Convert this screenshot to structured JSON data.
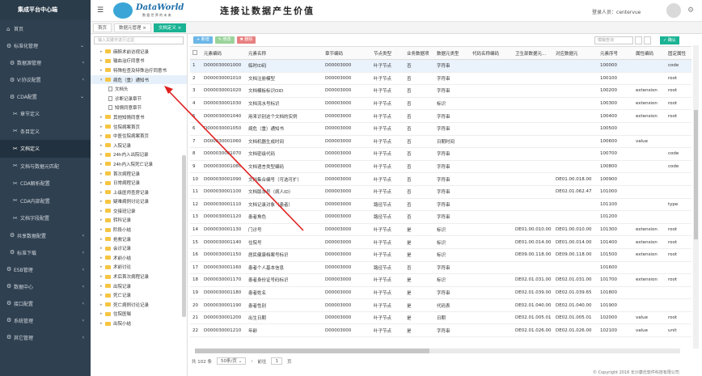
{
  "app": {
    "sidebar_title": "集成平台中心端"
  },
  "sidebar": {
    "items": [
      {
        "label": "首页",
        "icon": "home-icon",
        "level": 0
      },
      {
        "label": "标准化管理",
        "icon": "gear-icon",
        "level": 0,
        "arrow": "⌄"
      },
      {
        "label": "数据源管理",
        "icon": "cog-icon",
        "level": 1,
        "arrow": "‹"
      },
      {
        "label": "V:协议配置",
        "icon": "cog-icon",
        "level": 1,
        "arrow": "‹"
      },
      {
        "label": "CDA配置",
        "icon": "cog-icon",
        "level": 1,
        "arrow": "⌄"
      },
      {
        "label": "章节定义",
        "icon": "tool-icon",
        "level": 2
      },
      {
        "label": "条目定义",
        "icon": "tool-icon",
        "level": 2
      },
      {
        "label": "文档定义",
        "icon": "tool-icon",
        "level": 2,
        "active": true
      },
      {
        "label": "文档与数据元匹配",
        "icon": "tool-icon",
        "level": 2
      },
      {
        "label": "CDA解析配置",
        "icon": "tool-icon",
        "level": 2
      },
      {
        "label": "CDA内部配置",
        "icon": "tool-icon",
        "level": 2
      },
      {
        "label": "文档字段配置",
        "icon": "tool-icon",
        "level": 2
      },
      {
        "label": "共享数据配置",
        "icon": "cog-icon",
        "level": 1,
        "arrow": "‹"
      },
      {
        "label": "标准下载",
        "icon": "cog-icon",
        "level": 1,
        "arrow": "‹"
      },
      {
        "label": "ESB管理",
        "icon": "gear-icon",
        "level": 0,
        "arrow": "‹"
      },
      {
        "label": "数据中心",
        "icon": "gear-icon",
        "level": 0,
        "arrow": "‹"
      },
      {
        "label": "接口配置",
        "icon": "gear-icon",
        "level": 0,
        "arrow": "‹"
      },
      {
        "label": "系统管理",
        "icon": "gear-icon",
        "level": 0,
        "arrow": "‹"
      },
      {
        "label": "其它管理",
        "icon": "gear-icon",
        "level": 0,
        "arrow": "‹"
      }
    ]
  },
  "header": {
    "brand": "DataWorld",
    "brand_sub": "数 据 世 界 的 未 来",
    "slogan": "连接让数据产生价值",
    "login_label": "登录人员：",
    "user": "centervue"
  },
  "tabs": [
    "首页",
    "数据元管理 ×",
    "文档定义 ×"
  ],
  "tree": {
    "search_placeholder": "输入关键字进行过滤",
    "nodes": [
      {
        "label": "麻醉术前访视记录",
        "type": "folder",
        "tw": "▸"
      },
      {
        "label": "输血治疗同意书",
        "type": "folder",
        "tw": "▸"
      },
      {
        "label": "特殊检查及特殊治疗同意书",
        "type": "folder",
        "tw": "▸"
      },
      {
        "label": "病危（重）通知书",
        "type": "folder",
        "tw": "▾",
        "sel": true
      },
      {
        "label": "文档头",
        "type": "file"
      },
      {
        "label": "诊断记录章节",
        "type": "file"
      },
      {
        "label": "知情同意章节",
        "type": "file"
      },
      {
        "label": "其他知情同意书",
        "type": "folder",
        "tw": "▸"
      },
      {
        "label": "住院病案首页",
        "type": "folder",
        "tw": "▸"
      },
      {
        "label": "中医住院病案首页",
        "type": "folder",
        "tw": "▸"
      },
      {
        "label": "入院记录",
        "type": "folder",
        "tw": "▸"
      },
      {
        "label": "24h内入出院记录",
        "type": "folder",
        "tw": "▸"
      },
      {
        "label": "24h内入院死亡记录",
        "type": "folder",
        "tw": "▸"
      },
      {
        "label": "首次病程记录",
        "type": "folder",
        "tw": "▸"
      },
      {
        "label": "日常病程记录",
        "type": "folder",
        "tw": "▸"
      },
      {
        "label": "上级医师查房记录",
        "type": "folder",
        "tw": "▸"
      },
      {
        "label": "疑难病例讨论记录",
        "type": "folder",
        "tw": "▸"
      },
      {
        "label": "交接班记录",
        "type": "folder",
        "tw": "▸"
      },
      {
        "label": "转科记录",
        "type": "folder",
        "tw": "▸"
      },
      {
        "label": "阶段小结",
        "type": "folder",
        "tw": "▸"
      },
      {
        "label": "抢救记录",
        "type": "folder",
        "tw": "▸"
      },
      {
        "label": "会诊记录",
        "type": "folder",
        "tw": "▸"
      },
      {
        "label": "术前小结",
        "type": "folder",
        "tw": "▸"
      },
      {
        "label": "术前讨论",
        "type": "folder",
        "tw": "▸"
      },
      {
        "label": "术后首次病程记录",
        "type": "folder",
        "tw": "▸"
      },
      {
        "label": "出院记录",
        "type": "folder",
        "tw": "▸"
      },
      {
        "label": "死亡记录",
        "type": "folder",
        "tw": "▸"
      },
      {
        "label": "死亡病例讨论记录",
        "type": "folder",
        "tw": "▸"
      },
      {
        "label": "住院医嘱",
        "type": "folder",
        "tw": "▸"
      },
      {
        "label": "出院小结",
        "type": "folder",
        "tw": "▸"
      }
    ]
  },
  "toolbar": {
    "add": "+ 新增",
    "edit": "✎ 修改",
    "del": "✖ 删除",
    "search_placeholder": "模糊查询",
    "save": "✓ 确认"
  },
  "table": {
    "columns": [
      "",
      "元素编码",
      "元素名称",
      "章节编码",
      "节点类型",
      "业务数据项",
      "数据元类型",
      "代码名称编码",
      "卫生部数据元...",
      "对应数据元",
      "元素序号",
      "属性编码",
      "固定属性"
    ],
    "rows": [
      [
        "1",
        "D000030001000",
        "临时ID码",
        "D00003000",
        "叶子节点",
        "否",
        "字符串",
        "",
        "",
        "",
        "100000",
        "",
        "code"
      ],
      [
        "2",
        "D000030001010",
        "文档注册模型",
        "D00003000",
        "叶子节点",
        "否",
        "字符串",
        "",
        "",
        "",
        "100100",
        "",
        "root"
      ],
      [
        "3",
        "D000030001020",
        "文档模板标识OID",
        "D00003000",
        "叶子节点",
        "否",
        "字符串",
        "",
        "",
        "",
        "100200",
        "extension",
        "root"
      ],
      [
        "4",
        "D000030001030",
        "文档流水号标识",
        "D00003000",
        "叶子节点",
        "否",
        "标识",
        "",
        "",
        "",
        "100300",
        "extension",
        "root"
      ],
      [
        "5",
        "D000030001040",
        "用来识别这个文档的实例",
        "D00003000",
        "叶子节点",
        "否",
        "字符串",
        "",
        "",
        "",
        "100400",
        "extension",
        "root"
      ],
      [
        "6",
        "D000030001050",
        "病危（重）通知书",
        "D00003000",
        "叶子节点",
        "否",
        "字符串",
        "",
        "",
        "",
        "100500",
        "",
        ""
      ],
      [
        "7",
        "D000030001060",
        "文档机器生成时间",
        "D00003000",
        "叶子节点",
        "否",
        "日期时间",
        "",
        "",
        "",
        "100600",
        "value",
        ""
      ],
      [
        "8",
        "D000030001070",
        "文档密级代码",
        "D00003000",
        "叶子节点",
        "否",
        "字符串",
        "",
        "",
        "",
        "100700",
        "",
        "code"
      ],
      [
        "9",
        "D000030001080",
        "文档语言类型编码",
        "D00003000",
        "叶子节点",
        "否",
        "字符串",
        "",
        "",
        "",
        "100800",
        "",
        "code"
      ],
      [
        "10",
        "D000030001090",
        "文档集合编号（可选可扩）",
        "D00003000",
        "叶子节点",
        "否",
        "字符串",
        "",
        "",
        "DE01.00.018.00",
        "100900",
        "",
        ""
      ],
      [
        "11",
        "D000030001100",
        "文档版本号（病人ID）",
        "D00003000",
        "叶子节点",
        "否",
        "字符串",
        "",
        "",
        "DE02.01.062.47",
        "101000",
        "",
        ""
      ],
      [
        "12",
        "D000030001110",
        "文档记录对象（患者）",
        "D00003000",
        "路径节点",
        "否",
        "字符串",
        "",
        "",
        "",
        "101100",
        "",
        "type"
      ],
      [
        "13",
        "D000030001120",
        "患者角色",
        "D00003000",
        "路径节点",
        "否",
        "字符串",
        "",
        "",
        "",
        "101200",
        "",
        ""
      ],
      [
        "14",
        "D000030001130",
        "门诊号",
        "D00003000",
        "叶子节点",
        "是",
        "标识",
        "",
        "DE01.00.010.00",
        "DE01.00.010.00",
        "101300",
        "extension",
        "root"
      ],
      [
        "15",
        "D000030001140",
        "住院号",
        "D00003000",
        "叶子节点",
        "是",
        "标识",
        "",
        "DE01.00.014.00",
        "DE01.00.014.00",
        "101400",
        "extension",
        "root"
      ],
      [
        "16",
        "D000030001150",
        "居民健康档案号标识",
        "D00003000",
        "叶子节点",
        "是",
        "标识",
        "",
        "DE09.00.118.00",
        "DE09.00.118.00",
        "101500",
        "extension",
        "root"
      ],
      [
        "17",
        "D000030001160",
        "患者个人基本信息",
        "D00003000",
        "路径节点",
        "否",
        "字符串",
        "",
        "",
        "",
        "101600",
        "",
        ""
      ],
      [
        "18",
        "D000030001170",
        "患者身份证号码标识",
        "D00003000",
        "叶子节点",
        "是",
        "标识",
        "",
        "DE02.01.031.00",
        "DE02.01.031.00",
        "101700",
        "extension",
        "root"
      ],
      [
        "19",
        "D000030001180",
        "患者姓名",
        "D00003000",
        "叶子节点",
        "是",
        "字符串",
        "",
        "DE02.01.039.00",
        "DE02.01.039.65",
        "101800",
        "",
        ""
      ],
      [
        "20",
        "D000030001190",
        "患者性别",
        "D00003000",
        "叶子节点",
        "是",
        "代码表",
        "",
        "DE02.01.040.00",
        "DE02.01.040.00",
        "101900",
        "",
        ""
      ],
      [
        "21",
        "D000030001200",
        "出生日期",
        "D00003000",
        "叶子节点",
        "是",
        "日期",
        "",
        "DE02.01.005.01",
        "DE02.01.005.01",
        "102000",
        "value",
        "root"
      ],
      [
        "22",
        "D000030001210",
        "年龄",
        "D00003000",
        "叶子节点",
        "是",
        "字符串",
        "",
        "DE02.01.026.00",
        "DE02.01.026.00",
        "102100",
        "value",
        "unit"
      ]
    ]
  },
  "pager": {
    "total": "共 102 条",
    "size": "50条/页 ⌄",
    "prev": "‹",
    "label": "前往",
    "page": "1",
    "suffix": "页"
  },
  "copyright": "© Copyright 2016 长沙康氏软件科技有限公司"
}
